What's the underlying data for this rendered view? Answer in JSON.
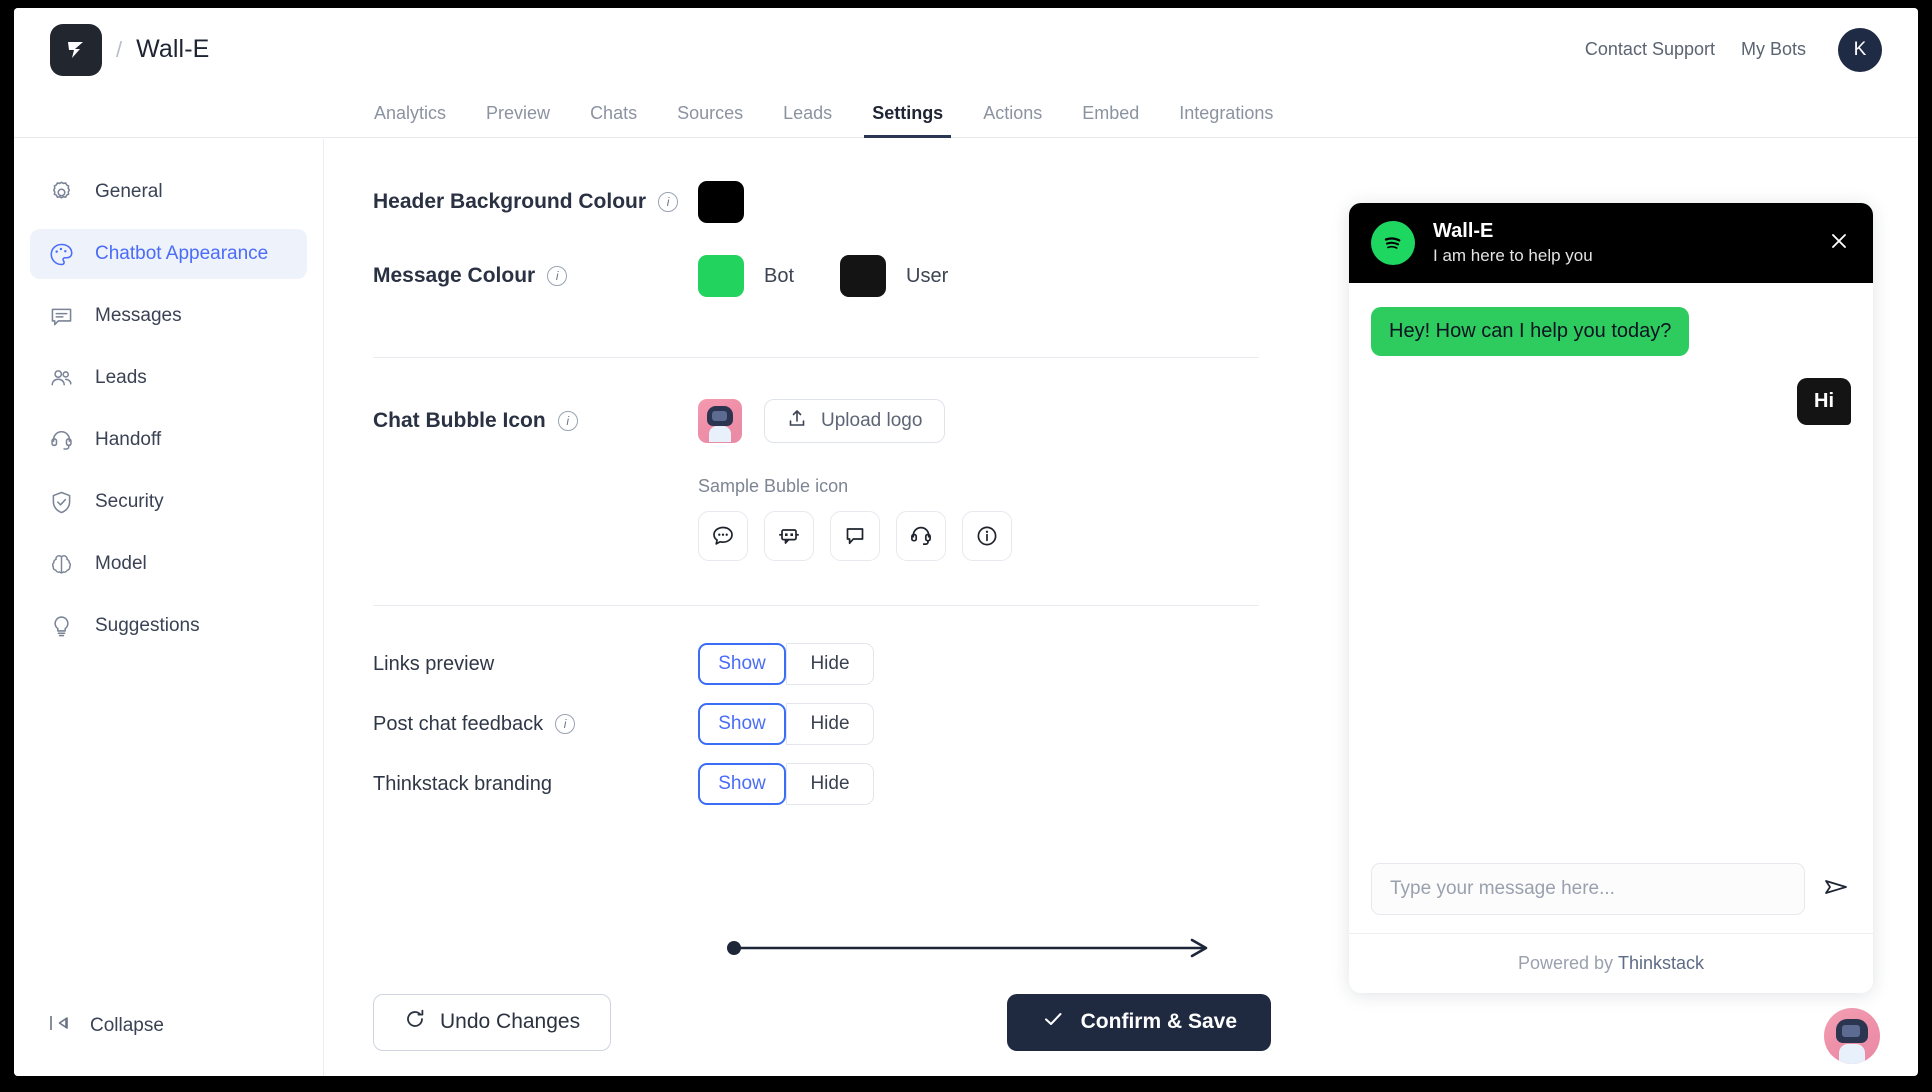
{
  "header": {
    "bot_name": "Wall-E",
    "separator": "/",
    "logo_icon": "thinkstack-logo-icon",
    "contact_support": "Contact Support",
    "my_bots": "My Bots",
    "avatar_initial": "K"
  },
  "tabs": [
    {
      "label": "Analytics",
      "active": false
    },
    {
      "label": "Preview",
      "active": false
    },
    {
      "label": "Chats",
      "active": false
    },
    {
      "label": "Sources",
      "active": false
    },
    {
      "label": "Leads",
      "active": false
    },
    {
      "label": "Settings",
      "active": true
    },
    {
      "label": "Actions",
      "active": false
    },
    {
      "label": "Embed",
      "active": false
    },
    {
      "label": "Integrations",
      "active": false
    }
  ],
  "sidebar": {
    "items": [
      {
        "label": "General",
        "icon": "gear-icon",
        "active": false
      },
      {
        "label": "Chatbot Appearance",
        "icon": "palette-icon",
        "active": true
      },
      {
        "label": "Messages",
        "icon": "message-icon",
        "active": false
      },
      {
        "label": "Leads",
        "icon": "users-icon",
        "active": false
      },
      {
        "label": "Handoff",
        "icon": "headset-icon",
        "active": false
      },
      {
        "label": "Security",
        "icon": "shield-check-icon",
        "active": false
      },
      {
        "label": "Model",
        "icon": "brain-icon",
        "active": false
      },
      {
        "label": "Suggestions",
        "icon": "lightbulb-icon",
        "active": false
      }
    ],
    "collapse_label": "Collapse",
    "collapse_icon": "collapse-arrow-icon"
  },
  "settings": {
    "header_bg": {
      "label": "Header Background Colour",
      "info_icon": "info-icon",
      "color": "#000000"
    },
    "message_colour": {
      "label": "Message Colour",
      "info_icon": "info-icon",
      "bot_color": "#22D35D",
      "bot_label": "Bot",
      "user_color": "#141414",
      "user_label": "User"
    },
    "chat_bubble_icon": {
      "label": "Chat Bubble Icon",
      "info_icon": "info-icon",
      "thumbnail_icon": "robot-avatar-thumbnail",
      "upload_label": "Upload logo",
      "upload_icon": "upload-icon",
      "sample_label": "Sample Buble icon",
      "samples": [
        "chat-dots-icon",
        "chat-robot-icon",
        "speech-bubble-icon",
        "headset-icon",
        "info-circle-icon"
      ]
    },
    "toggles": [
      {
        "label": "Links preview",
        "has_info": false,
        "options": [
          "Show",
          "Hide"
        ],
        "selected": "Show",
        "highlighted": false
      },
      {
        "label": "Post chat feedback",
        "has_info": true,
        "options": [
          "Show",
          "Hide"
        ],
        "selected": "Show",
        "highlighted": false
      },
      {
        "label": "Thinkstack branding",
        "has_info": false,
        "options": [
          "Show",
          "Hide"
        ],
        "selected": "Show",
        "highlighted": true
      }
    ],
    "undo_label": "Undo Changes",
    "undo_icon": "refresh-icon",
    "save_label": "Confirm & Save",
    "save_icon": "check-icon"
  },
  "preview": {
    "avatar_icon": "spotify-logo-icon",
    "title": "Wall-E",
    "subtitle": "I am here to help you",
    "close_icon": "close-icon",
    "messages": [
      {
        "from": "bot",
        "text": "Hey! How can I help you today?"
      },
      {
        "from": "user",
        "text": "Hi"
      }
    ],
    "input_placeholder": "Type your message here...",
    "send_icon": "send-icon",
    "footer_prefix": "Powered by",
    "footer_brand": "Thinkstack",
    "fab_icon": "robot-avatar-fab"
  },
  "colors": {
    "accent_blue": "#4a6cf7",
    "dark": "#1f2a41",
    "green": "#22D35D"
  }
}
